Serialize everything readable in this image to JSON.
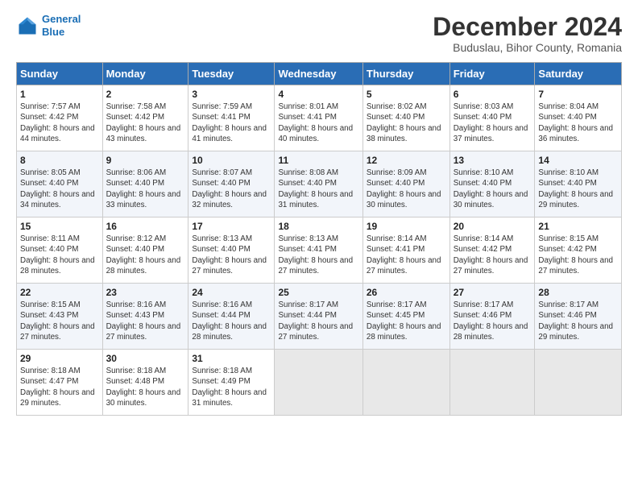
{
  "logo": {
    "line1": "General",
    "line2": "Blue"
  },
  "title": "December 2024",
  "subtitle": "Buduslau, Bihor County, Romania",
  "days": [
    "Sunday",
    "Monday",
    "Tuesday",
    "Wednesday",
    "Thursday",
    "Friday",
    "Saturday"
  ],
  "weeks": [
    [
      {
        "day": "1",
        "sunrise": "7:57 AM",
        "sunset": "4:42 PM",
        "daylight": "8 hours and 44 minutes."
      },
      {
        "day": "2",
        "sunrise": "7:58 AM",
        "sunset": "4:42 PM",
        "daylight": "8 hours and 43 minutes."
      },
      {
        "day": "3",
        "sunrise": "7:59 AM",
        "sunset": "4:41 PM",
        "daylight": "8 hours and 41 minutes."
      },
      {
        "day": "4",
        "sunrise": "8:01 AM",
        "sunset": "4:41 PM",
        "daylight": "8 hours and 40 minutes."
      },
      {
        "day": "5",
        "sunrise": "8:02 AM",
        "sunset": "4:40 PM",
        "daylight": "8 hours and 38 minutes."
      },
      {
        "day": "6",
        "sunrise": "8:03 AM",
        "sunset": "4:40 PM",
        "daylight": "8 hours and 37 minutes."
      },
      {
        "day": "7",
        "sunrise": "8:04 AM",
        "sunset": "4:40 PM",
        "daylight": "8 hours and 36 minutes."
      }
    ],
    [
      {
        "day": "8",
        "sunrise": "8:05 AM",
        "sunset": "4:40 PM",
        "daylight": "8 hours and 34 minutes."
      },
      {
        "day": "9",
        "sunrise": "8:06 AM",
        "sunset": "4:40 PM",
        "daylight": "8 hours and 33 minutes."
      },
      {
        "day": "10",
        "sunrise": "8:07 AM",
        "sunset": "4:40 PM",
        "daylight": "8 hours and 32 minutes."
      },
      {
        "day": "11",
        "sunrise": "8:08 AM",
        "sunset": "4:40 PM",
        "daylight": "8 hours and 31 minutes."
      },
      {
        "day": "12",
        "sunrise": "8:09 AM",
        "sunset": "4:40 PM",
        "daylight": "8 hours and 30 minutes."
      },
      {
        "day": "13",
        "sunrise": "8:10 AM",
        "sunset": "4:40 PM",
        "daylight": "8 hours and 30 minutes."
      },
      {
        "day": "14",
        "sunrise": "8:10 AM",
        "sunset": "4:40 PM",
        "daylight": "8 hours and 29 minutes."
      }
    ],
    [
      {
        "day": "15",
        "sunrise": "8:11 AM",
        "sunset": "4:40 PM",
        "daylight": "8 hours and 28 minutes."
      },
      {
        "day": "16",
        "sunrise": "8:12 AM",
        "sunset": "4:40 PM",
        "daylight": "8 hours and 28 minutes."
      },
      {
        "day": "17",
        "sunrise": "8:13 AM",
        "sunset": "4:40 PM",
        "daylight": "8 hours and 27 minutes."
      },
      {
        "day": "18",
        "sunrise": "8:13 AM",
        "sunset": "4:41 PM",
        "daylight": "8 hours and 27 minutes."
      },
      {
        "day": "19",
        "sunrise": "8:14 AM",
        "sunset": "4:41 PM",
        "daylight": "8 hours and 27 minutes."
      },
      {
        "day": "20",
        "sunrise": "8:14 AM",
        "sunset": "4:42 PM",
        "daylight": "8 hours and 27 minutes."
      },
      {
        "day": "21",
        "sunrise": "8:15 AM",
        "sunset": "4:42 PM",
        "daylight": "8 hours and 27 minutes."
      }
    ],
    [
      {
        "day": "22",
        "sunrise": "8:15 AM",
        "sunset": "4:43 PM",
        "daylight": "8 hours and 27 minutes."
      },
      {
        "day": "23",
        "sunrise": "8:16 AM",
        "sunset": "4:43 PM",
        "daylight": "8 hours and 27 minutes."
      },
      {
        "day": "24",
        "sunrise": "8:16 AM",
        "sunset": "4:44 PM",
        "daylight": "8 hours and 28 minutes."
      },
      {
        "day": "25",
        "sunrise": "8:17 AM",
        "sunset": "4:44 PM",
        "daylight": "8 hours and 27 minutes."
      },
      {
        "day": "26",
        "sunrise": "8:17 AM",
        "sunset": "4:45 PM",
        "daylight": "8 hours and 28 minutes."
      },
      {
        "day": "27",
        "sunrise": "8:17 AM",
        "sunset": "4:46 PM",
        "daylight": "8 hours and 28 minutes."
      },
      {
        "day": "28",
        "sunrise": "8:17 AM",
        "sunset": "4:46 PM",
        "daylight": "8 hours and 29 minutes."
      }
    ],
    [
      {
        "day": "29",
        "sunrise": "8:18 AM",
        "sunset": "4:47 PM",
        "daylight": "8 hours and 29 minutes."
      },
      {
        "day": "30",
        "sunrise": "8:18 AM",
        "sunset": "4:48 PM",
        "daylight": "8 hours and 30 minutes."
      },
      {
        "day": "31",
        "sunrise": "8:18 AM",
        "sunset": "4:49 PM",
        "daylight": "8 hours and 31 minutes."
      },
      null,
      null,
      null,
      null
    ]
  ]
}
